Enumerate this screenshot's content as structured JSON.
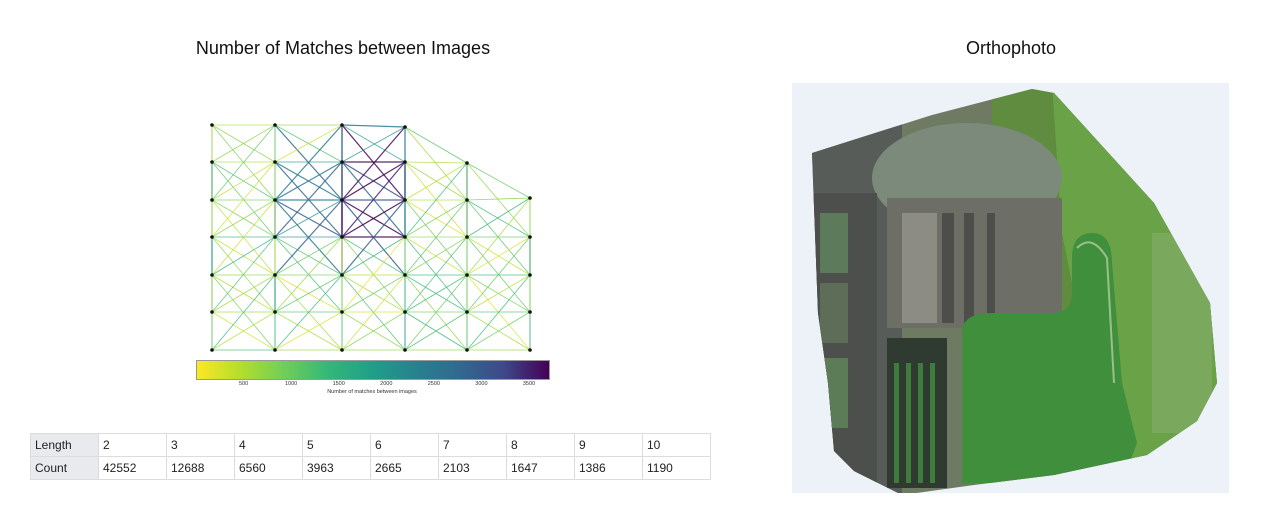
{
  "matches_title": "Number of Matches between Images",
  "ortho_title": "Orthophoto",
  "chart_data": {
    "type": "network",
    "title": "Number of Matches between Images",
    "colorbar": {
      "label": "Number of matches between images",
      "ticks": [
        "500",
        "1000",
        "1500",
        "2000",
        "2500",
        "3000",
        "3500"
      ],
      "range": [
        0,
        3700
      ],
      "colormap": "viridis-reversed"
    },
    "grid_columns": 6,
    "grid_rows": 7,
    "track_table": {
      "row_labels": [
        "Length",
        "Count"
      ],
      "length": [
        "2",
        "3",
        "4",
        "5",
        "6",
        "7",
        "8",
        "9",
        "10"
      ],
      "count": [
        "42552",
        "12688",
        "6560",
        "3963",
        "2665",
        "2103",
        "1647",
        "1386",
        "1190"
      ]
    }
  },
  "colors": {
    "low": "#fde725",
    "high": "#440154",
    "ortho_background": "#edf1f8"
  }
}
